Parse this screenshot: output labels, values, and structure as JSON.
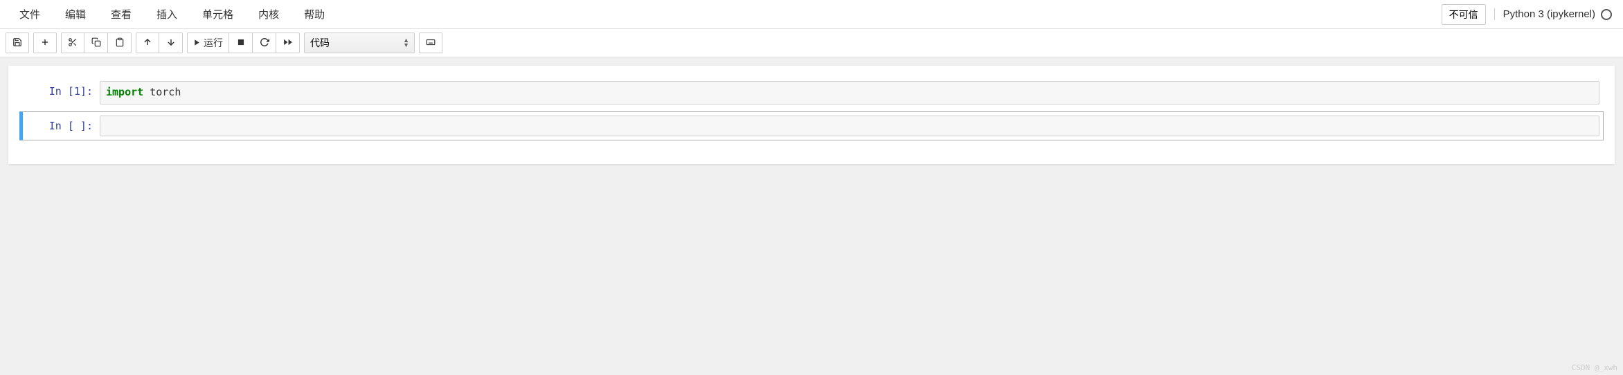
{
  "menu": {
    "file": "文件",
    "edit": "编辑",
    "view": "查看",
    "insert": "插入",
    "cell": "单元格",
    "kernel": "内核",
    "help": "帮助"
  },
  "header": {
    "trusted_label": "不可信",
    "kernel_name": "Python 3 (ipykernel)"
  },
  "toolbar": {
    "run_label": "运行",
    "cell_type": "代码"
  },
  "cells": [
    {
      "prompt": "In [1]:",
      "code_keyword": "import",
      "code_rest": " torch",
      "selected": false
    },
    {
      "prompt": "In [ ]:",
      "code_keyword": "",
      "code_rest": "",
      "selected": true
    }
  ],
  "watermark": "CSDN @_xwh"
}
